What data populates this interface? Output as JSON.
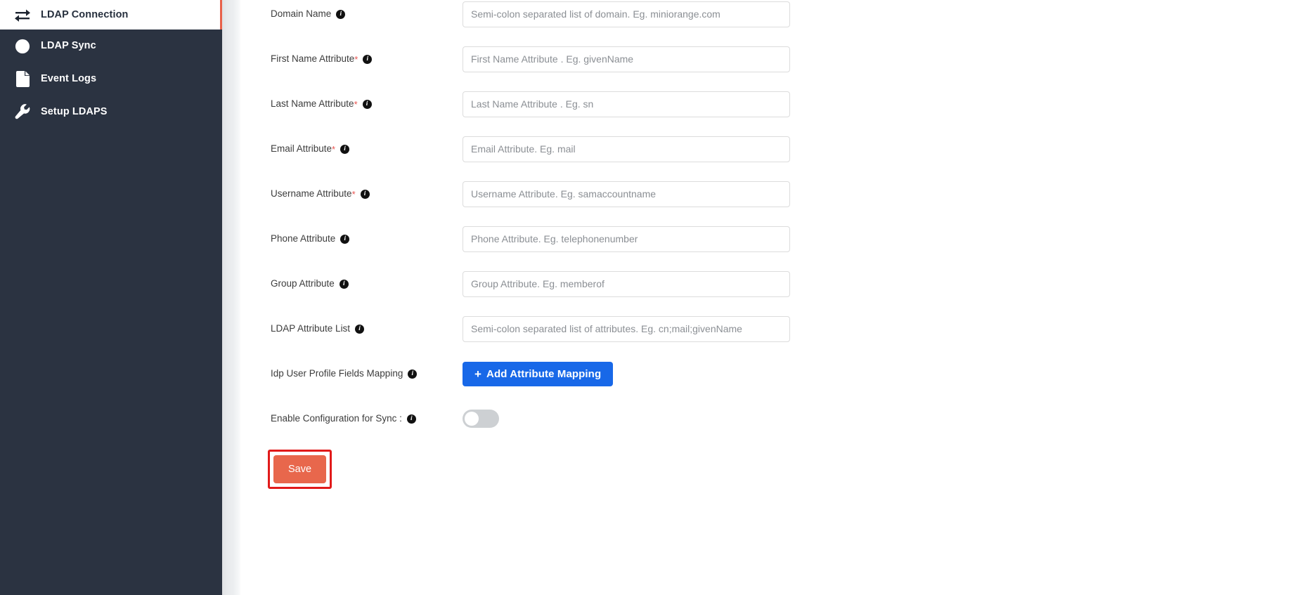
{
  "sidebar": {
    "items": [
      {
        "label": "LDAP Connection",
        "icon": "exchange-arrows-icon",
        "active": true,
        "name": "ldap-connection"
      },
      {
        "label": "LDAP Sync",
        "icon": "clock-icon",
        "active": false,
        "name": "ldap-sync"
      },
      {
        "label": "Event Logs",
        "icon": "document-icon",
        "active": false,
        "name": "event-logs"
      },
      {
        "label": "Setup LDAPS",
        "icon": "wrench-icon",
        "active": false,
        "name": "setup-ldaps"
      }
    ],
    "active_accent_color": "#e8614a",
    "background_color": "#2b3341"
  },
  "form": {
    "info_icon_glyph": "i",
    "required_marker": "*",
    "fields": [
      {
        "label": "Domain Name",
        "required": false,
        "placeholder": "Semi-colon separated list of domain. Eg. miniorange.com",
        "value": "",
        "name": "domain-name"
      },
      {
        "label": "First Name Attribute",
        "required": true,
        "placeholder": "First Name Attribute . Eg. givenName",
        "value": "",
        "name": "first-name-attribute"
      },
      {
        "label": "Last Name Attribute",
        "required": true,
        "placeholder": "Last Name Attribute . Eg. sn",
        "value": "",
        "name": "last-name-attribute"
      },
      {
        "label": "Email Attribute",
        "required": true,
        "placeholder": "Email Attribute. Eg. mail",
        "value": "",
        "name": "email-attribute"
      },
      {
        "label": "Username Attribute",
        "required": true,
        "placeholder": "Username Attribute. Eg. samaccountname",
        "value": "",
        "name": "username-attribute"
      },
      {
        "label": "Phone Attribute",
        "required": false,
        "placeholder": "Phone Attribute. Eg. telephonenumber",
        "value": "",
        "name": "phone-attribute"
      },
      {
        "label": "Group Attribute",
        "required": false,
        "placeholder": "Group Attribute. Eg. memberof",
        "value": "",
        "name": "group-attribute"
      },
      {
        "label": "LDAP Attribute List",
        "required": false,
        "placeholder": "Semi-colon separated list of attributes. Eg. cn;mail;givenName",
        "value": "",
        "name": "ldap-attribute-list"
      }
    ],
    "mapping_row": {
      "label": "Idp User Profile Fields Mapping",
      "button_label": "Add Attribute Mapping",
      "button_plus": "+",
      "button_color": "#1868e8"
    },
    "sync_row": {
      "label": "Enable Configuration for Sync :",
      "toggle_state": "off",
      "toggle_color": "#cdd0d3"
    },
    "save": {
      "label": "Save",
      "button_color": "#e8674c",
      "highlight_color": "#e11a1a"
    }
  }
}
